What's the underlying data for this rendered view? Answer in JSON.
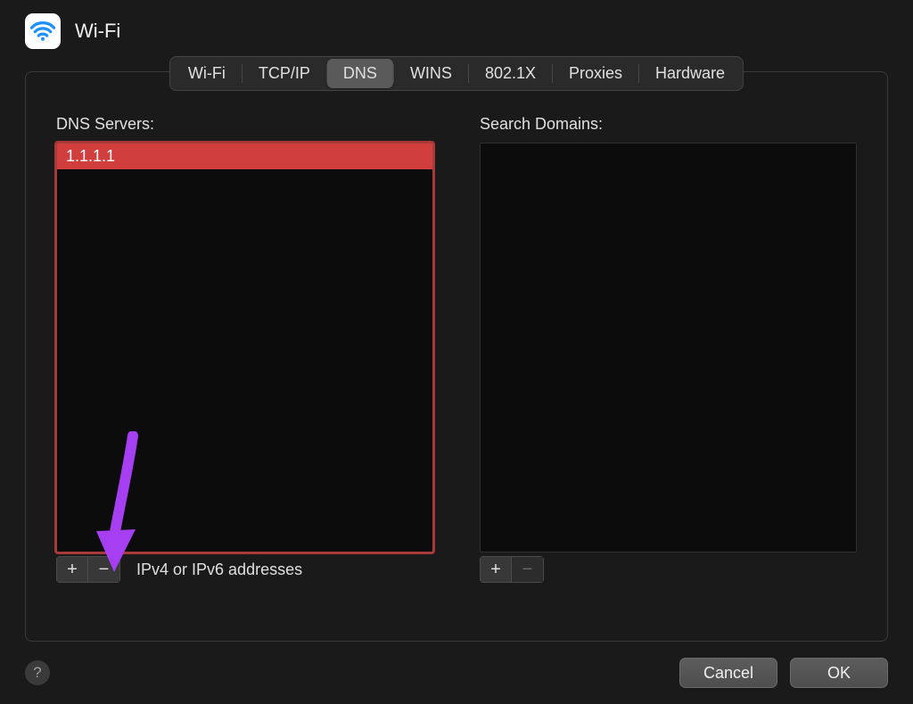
{
  "header": {
    "title": "Wi-Fi"
  },
  "tabs": [
    {
      "label": "Wi-Fi",
      "active": false
    },
    {
      "label": "TCP/IP",
      "active": false
    },
    {
      "label": "DNS",
      "active": true
    },
    {
      "label": "WINS",
      "active": false
    },
    {
      "label": "802.1X",
      "active": false
    },
    {
      "label": "Proxies",
      "active": false
    },
    {
      "label": "Hardware",
      "active": false
    }
  ],
  "left": {
    "label": "DNS Servers:",
    "items": [
      "1.1.1.1"
    ],
    "hint": "IPv4 or IPv6 addresses",
    "plus": "+",
    "minus": "−"
  },
  "right": {
    "label": "Search Domains:",
    "plus": "+",
    "minus": "−"
  },
  "footer": {
    "help": "?",
    "cancel": "Cancel",
    "ok": "OK"
  },
  "colors": {
    "highlight": "#d13e3e",
    "arrow": "#a63ef1"
  }
}
